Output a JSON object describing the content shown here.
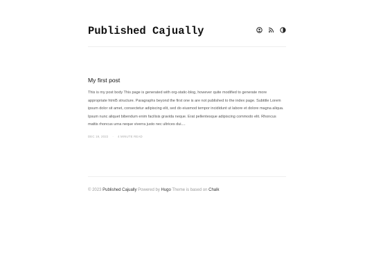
{
  "header": {
    "site_title": "Published Cajually",
    "icons": [
      "github-icon",
      "rss-icon",
      "theme-toggle-icon"
    ]
  },
  "post": {
    "title": "My first post",
    "body": "This is my post body This page is generated with org-static-blog, however quite modified to generate more appropriate html5 structure. Paragraphs beyond the first one is are not published to the index page. Subtitle Lorem ipsum dolor sit amet, consectetur adipiscing elit, sed do eiusmod tempor incididunt ut labore et dolore magna aliqua. Ipsum nunc aliquet bibendum enim facilisis gravida neque. Erat pellentesque adipiscing commodo elit. Rhoncus mattis rhoncus urna neque viverra justo nec ultrices dui....",
    "date": "DEC 19, 2022",
    "separator": "·",
    "read_time": "4 MINUTE READ"
  },
  "footer": {
    "copyright": "© 2023 ",
    "site_link": "Published Cajually",
    "powered_by": " Powered by ",
    "hugo_link": "Hugo",
    "theme_text": " Theme is based on ",
    "chalk_link": "Chalk"
  }
}
